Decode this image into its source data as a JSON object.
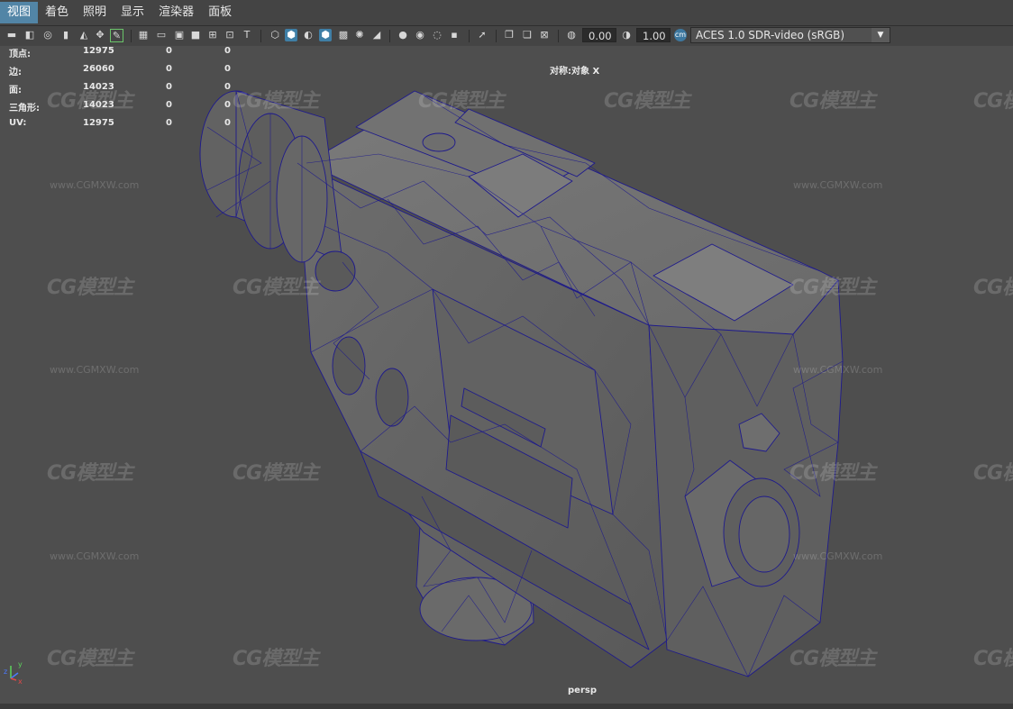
{
  "menu": {
    "items": [
      "视图",
      "着色",
      "照明",
      "显示",
      "渲染器",
      "面板"
    ]
  },
  "toolbar": {
    "exposure_value": "0.00",
    "gamma_value": "1.00",
    "color_space": "ACES 1.0 SDR-video (sRGB)",
    "icons": [
      "camera-icon",
      "camera-attributes-icon",
      "bookmark-icon",
      "image-plane-icon",
      "grease-pencil-icon",
      "grid-icon",
      "film-gate-icon",
      "resolution-gate-icon",
      "gate-mask-icon",
      "field-chart-icon",
      "safe-action-icon",
      "safe-title-icon",
      "wireframe-icon",
      "smooth-shade-icon",
      "default-material-icon",
      "wireframe-on-shaded-icon",
      "textured-icon",
      "lights-icon",
      "shadows-icon",
      "screen-space-ao-icon",
      "motion-blur-icon",
      "antialiasing-icon",
      "depth-of-field-icon",
      "isolate-select-icon",
      "xray-icon",
      "xray-active-icon",
      "xray-joints-icon",
      "exposure-icon",
      "gamma-icon",
      "color-management-icon"
    ]
  },
  "hud": {
    "stats": [
      {
        "label": "顶点:",
        "v1": "12975",
        "v2": "0",
        "v3": "0"
      },
      {
        "label": "边:",
        "v1": "26060",
        "v2": "0",
        "v3": "0"
      },
      {
        "label": "面:",
        "v1": "14023",
        "v2": "0",
        "v3": "0"
      },
      {
        "label": "三角形:",
        "v1": "14023",
        "v2": "0",
        "v3": "0"
      },
      {
        "label": "UV:",
        "v1": "12975",
        "v2": "0",
        "v3": "0"
      }
    ],
    "symmetry": "对称:对象 X",
    "camera_name": "persp",
    "axis_labels": {
      "x": "x",
      "y": "y",
      "z": "z"
    }
  },
  "watermark": {
    "logo_text": "CG模型主",
    "url": "www.CGMXW.com"
  },
  "colors": {
    "active_menu": "#5285a6",
    "viewport_bg": "#4e4e4e",
    "wire": "#1e1a8c",
    "mesh_fill": "#6a6a6a"
  }
}
